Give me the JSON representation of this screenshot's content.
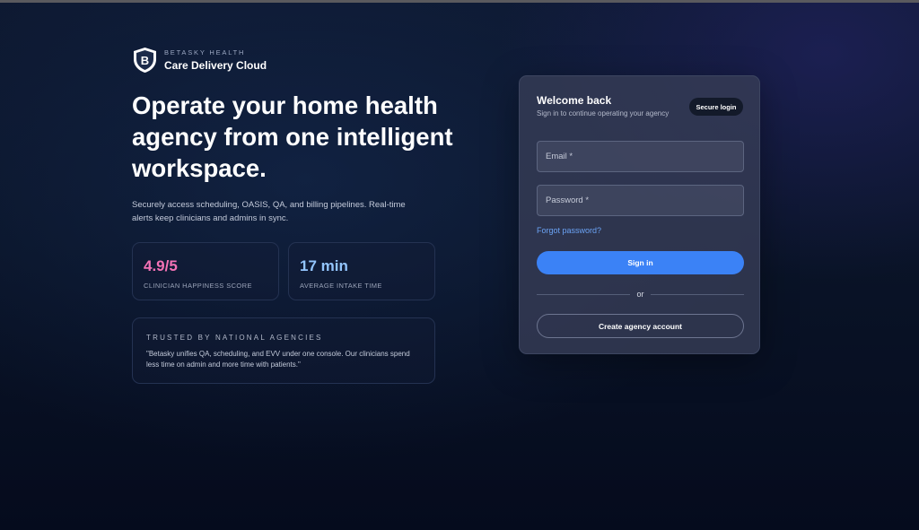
{
  "brand": {
    "eyebrow": "BETASKY HEALTH",
    "name": "Care Delivery Cloud",
    "logo_letter": "B",
    "logo_icon": "shield-icon"
  },
  "hero": {
    "title": "Operate your home health agency from one intelligent workspace.",
    "subtitle": "Securely access scheduling, OASIS, QA, and billing pipelines. Real-time alerts keep clinicians and admins in sync."
  },
  "stats": [
    {
      "value": "4.9/5",
      "label": "CLINICIAN HAPPINESS SCORE",
      "color": "#f472b6"
    },
    {
      "value": "17 min",
      "label": "AVERAGE INTAKE TIME",
      "color": "#93c5fd"
    }
  ],
  "testimonial": {
    "eyebrow": "TRUSTED BY NATIONAL AGENCIES",
    "quote": "\"Betasky unifies QA, scheduling, and EVV under one console. Our clinicians spend less time on admin and more time with patients.\""
  },
  "login": {
    "title": "Welcome back",
    "subtitle": "Sign in to continue operating your agency",
    "badge": "Secure login",
    "email_placeholder": "Email *",
    "email_value": "",
    "password_placeholder": "Password *",
    "password_value": "",
    "forgot": "Forgot password?",
    "signin": "Sign in",
    "divider": "or",
    "create": "Create agency account"
  },
  "colors": {
    "accent": "#3b82f6",
    "link": "#6ba3f5",
    "stat_pink": "#f472b6",
    "stat_blue": "#93c5fd"
  }
}
